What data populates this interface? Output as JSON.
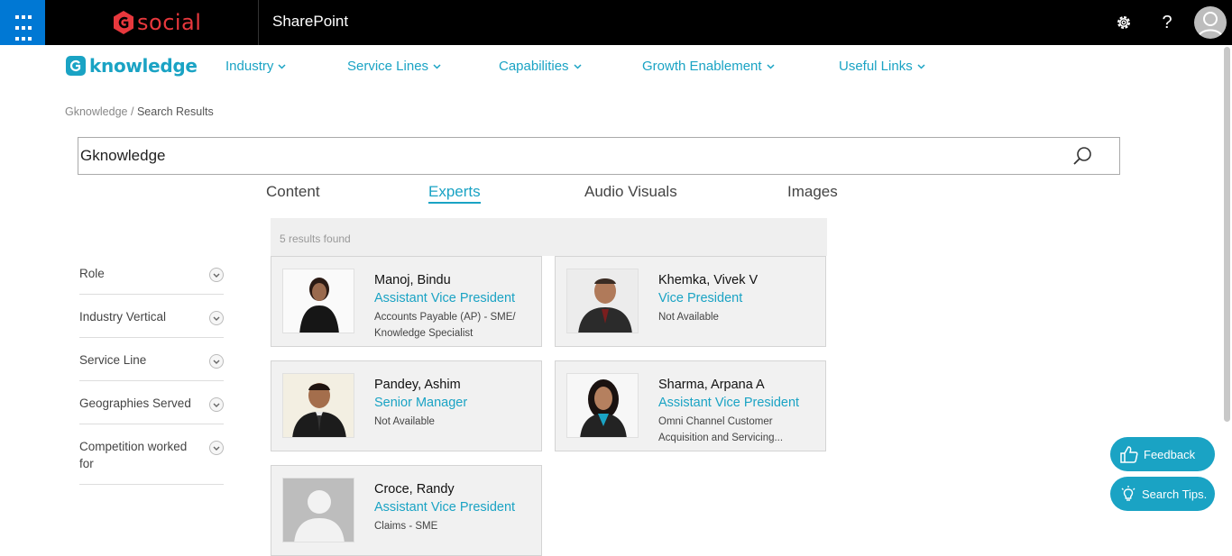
{
  "suitebar": {
    "brand": "social",
    "app_title": "SharePoint",
    "icons": [
      "app-launcher-icon",
      "gear-icon",
      "help-icon",
      "user-avatar-icon"
    ],
    "help_glyph": "?"
  },
  "site": {
    "logo_text": "knowledge",
    "nav": [
      {
        "label": "Industry"
      },
      {
        "label": "Service Lines"
      },
      {
        "label": "Capabilities"
      },
      {
        "label": "Growth Enablement"
      },
      {
        "label": "Useful Links"
      }
    ],
    "accent": "#1aa3c4"
  },
  "breadcrumb": {
    "root": "Gknowledge",
    "separator": "/",
    "current": "Search Results"
  },
  "search": {
    "value": "Gknowledge",
    "icon": "search-icon"
  },
  "tabs": [
    {
      "label": "Content",
      "active": false
    },
    {
      "label": "Experts",
      "active": true
    },
    {
      "label": "Audio Visuals",
      "active": false
    },
    {
      "label": "Images",
      "active": false
    }
  ],
  "filters": [
    {
      "label": "Role"
    },
    {
      "label": "Industry Vertical"
    },
    {
      "label": "Service Line"
    },
    {
      "label": "Geographies Served"
    },
    {
      "label": "Competition worked for"
    }
  ],
  "results": {
    "count_text": "5 results found",
    "experts": [
      {
        "name": "Manoj, Bindu",
        "title": "Assistant Vice President",
        "detail": "Accounts Payable (AP) - SME/ Knowledge Specialist"
      },
      {
        "name": "Khemka, Vivek V",
        "title": "Vice President",
        "detail": "Not Available"
      },
      {
        "name": "Pandey, Ashim",
        "title": "Senior Manager",
        "detail": "Not Available"
      },
      {
        "name": "Sharma, Arpana A",
        "title": "Assistant Vice President",
        "detail": "Omni Channel Customer Acquisition and Servicing..."
      },
      {
        "name": "Croce, Randy",
        "title": "Assistant Vice President",
        "detail": "Claims - SME"
      }
    ]
  },
  "floating": {
    "feedback": "Feedback",
    "search_tips": "Search Tips."
  }
}
